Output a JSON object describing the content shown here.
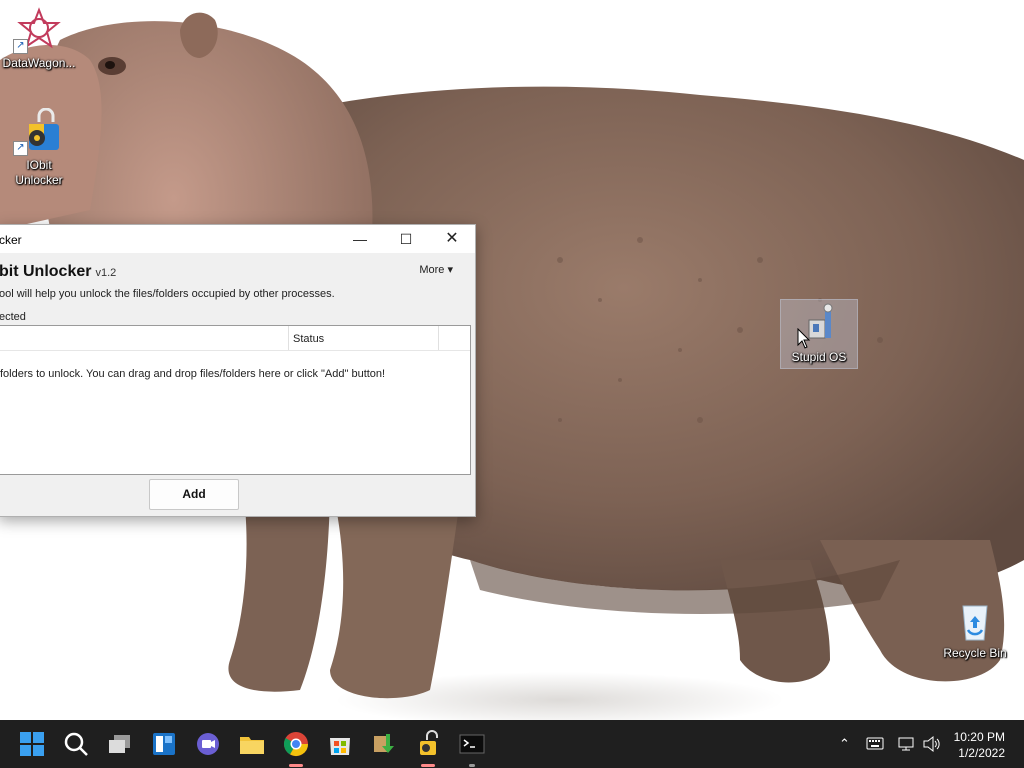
{
  "desktop": {
    "icons": [
      {
        "label": "DataWagon..."
      },
      {
        "label": "IObit Unlocker"
      },
      {
        "label": "Stupid OS"
      },
      {
        "label": "Recycle Bin"
      }
    ]
  },
  "window": {
    "title": "cker",
    "app_name": "bit Unlocker",
    "version": "v1.2",
    "more_label": "More",
    "description": "ool will help you unlock the files/folders occupied by other processes.",
    "selected_label": "ected",
    "columns": [
      "",
      "Status"
    ],
    "empty_hint": "folders to unlock. You can drag and drop files/folders here or click \"Add\" button!",
    "add_label": "Add"
  },
  "taskbar": {
    "apps": [
      {
        "icon": "windows-start-icon"
      },
      {
        "icon": "search-icon"
      },
      {
        "icon": "task-view-icon"
      },
      {
        "icon": "widgets-icon"
      },
      {
        "icon": "teams-chat-icon"
      },
      {
        "icon": "file-explorer-icon"
      },
      {
        "icon": "chrome-icon"
      },
      {
        "icon": "store-icon"
      },
      {
        "icon": "installer-icon"
      },
      {
        "icon": "iobit-unlocker-icon"
      },
      {
        "icon": "terminal-icon"
      }
    ],
    "clock_time": "10:20 PM",
    "clock_date": "1/2/2022"
  },
  "colors": {
    "taskbar_bg": "#1f1f1f",
    "window_bg": "#f0f0f0",
    "active_indicator": "#ff8a8a"
  }
}
